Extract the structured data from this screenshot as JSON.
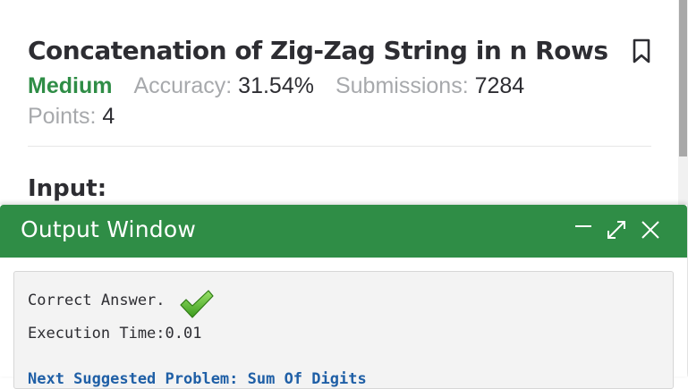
{
  "problem": {
    "title": "Concatenation of Zig-Zag String in n Rows",
    "difficulty": "Medium",
    "accuracy_label": "Accuracy:",
    "accuracy_value": "31.54%",
    "submissions_label": "Submissions:",
    "submissions_value": "7284",
    "points_label": "Points:",
    "points_value": "4"
  },
  "section": {
    "heading": "Input:"
  },
  "output_window": {
    "title": "Output Window",
    "result_text": "Correct Answer.",
    "execution_time": "Execution Time:0.01",
    "next_link": "Next Suggested Problem: Sum Of Digits"
  },
  "icons": {
    "bookmark": "bookmark-icon",
    "minimize": "minimize-icon",
    "maximize": "expand-icon",
    "close": "close-icon",
    "check": "checkmark-icon"
  },
  "colors": {
    "brand_green": "#2f8d46",
    "title_text": "#2d2d32",
    "muted_text": "#a7a9ac",
    "link_blue": "#1f5fa6"
  }
}
